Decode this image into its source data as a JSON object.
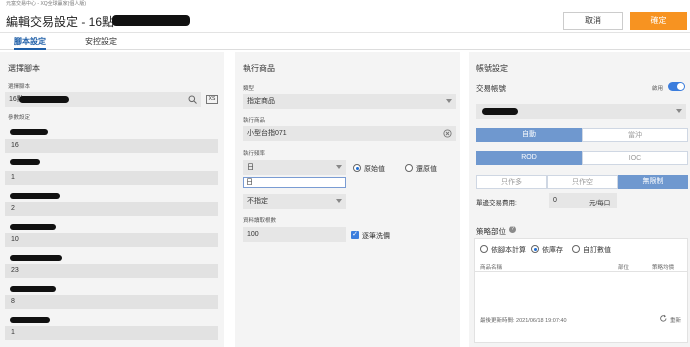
{
  "window": {
    "title": "元富交易中心 - XQ全球贏家(個人版)"
  },
  "dialog": {
    "title": "編輯交易設定 - 16點",
    "cancel_label": "取消",
    "ok_label": "確定"
  },
  "tabs": [
    {
      "label": "腳本設定"
    },
    {
      "label": "安控設定"
    }
  ],
  "script_panel": {
    "title": "選擇腳本",
    "script_label": "選擇腳本",
    "script_value": "16點",
    "params_label": "參數設定",
    "params": [
      "16",
      "1",
      "2",
      "10",
      "23",
      "8",
      "1"
    ]
  },
  "product_panel": {
    "title": "執行商品",
    "type_label": "類型",
    "type_value": "指定商品",
    "product_label": "執行商品",
    "product_value": "小型台指071",
    "freq_label": "執行頻率",
    "freq_value": "日",
    "freq_option": "日",
    "adj_options": [
      "原始值",
      "還原值"
    ],
    "adj_selected": 0,
    "base_value": "不指定",
    "bars_label": "資料讀取根數",
    "bars_value": "100",
    "checkbox_label": "逐筆洗價"
  },
  "account_panel": {
    "title": "帳號設定",
    "trade_account_label": "交易帳號",
    "enable_label": "啟用",
    "seg1": [
      "自動",
      "當沖"
    ],
    "seg2": [
      "ROD",
      "IOC"
    ],
    "seg3": [
      "只作多",
      "只作空",
      "無限制"
    ],
    "fee_label": "單邊交易費用:",
    "fee_value": "0",
    "fee_unit": "元/每口"
  },
  "strategy_panel": {
    "title": "策略部位",
    "options": [
      "依腳本計算",
      "依庫存",
      "自訂數值"
    ],
    "selected": 1,
    "columns": [
      "商品名稱",
      "部位",
      "策略均價"
    ],
    "updated_label": "最後更新時間: 2021/06/18 19:07:40",
    "refresh_label": "重新"
  },
  "colors": {
    "accent": "#f79321",
    "brand_blue": "#1f5fa8",
    "segment_on": "#6f98cf"
  },
  "icons": [
    "search-icon",
    "clear-icon",
    "xs-icon",
    "chevron-down-icon",
    "refresh-icon",
    "help-icon"
  ]
}
